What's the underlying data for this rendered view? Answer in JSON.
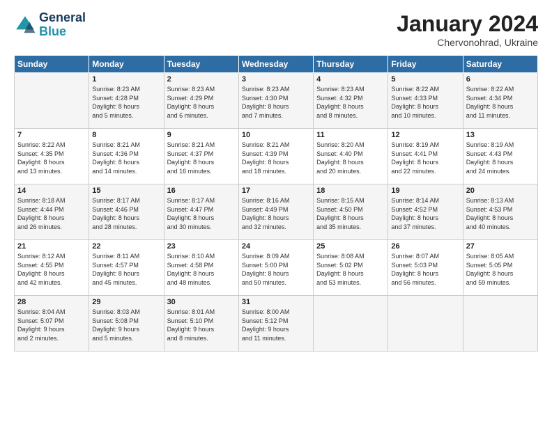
{
  "logo": {
    "line1": "General",
    "line2": "Blue"
  },
  "title": "January 2024",
  "subtitle": "Chervonohrad, Ukraine",
  "days_header": [
    "Sunday",
    "Monday",
    "Tuesday",
    "Wednesday",
    "Thursday",
    "Friday",
    "Saturday"
  ],
  "weeks": [
    [
      {
        "day": "",
        "info": ""
      },
      {
        "day": "1",
        "info": "Sunrise: 8:23 AM\nSunset: 4:28 PM\nDaylight: 8 hours\nand 5 minutes."
      },
      {
        "day": "2",
        "info": "Sunrise: 8:23 AM\nSunset: 4:29 PM\nDaylight: 8 hours\nand 6 minutes."
      },
      {
        "day": "3",
        "info": "Sunrise: 8:23 AM\nSunset: 4:30 PM\nDaylight: 8 hours\nand 7 minutes."
      },
      {
        "day": "4",
        "info": "Sunrise: 8:23 AM\nSunset: 4:32 PM\nDaylight: 8 hours\nand 8 minutes."
      },
      {
        "day": "5",
        "info": "Sunrise: 8:22 AM\nSunset: 4:33 PM\nDaylight: 8 hours\nand 10 minutes."
      },
      {
        "day": "6",
        "info": "Sunrise: 8:22 AM\nSunset: 4:34 PM\nDaylight: 8 hours\nand 11 minutes."
      }
    ],
    [
      {
        "day": "7",
        "info": "Sunrise: 8:22 AM\nSunset: 4:35 PM\nDaylight: 8 hours\nand 13 minutes."
      },
      {
        "day": "8",
        "info": "Sunrise: 8:21 AM\nSunset: 4:36 PM\nDaylight: 8 hours\nand 14 minutes."
      },
      {
        "day": "9",
        "info": "Sunrise: 8:21 AM\nSunset: 4:37 PM\nDaylight: 8 hours\nand 16 minutes."
      },
      {
        "day": "10",
        "info": "Sunrise: 8:21 AM\nSunset: 4:39 PM\nDaylight: 8 hours\nand 18 minutes."
      },
      {
        "day": "11",
        "info": "Sunrise: 8:20 AM\nSunset: 4:40 PM\nDaylight: 8 hours\nand 20 minutes."
      },
      {
        "day": "12",
        "info": "Sunrise: 8:19 AM\nSunset: 4:41 PM\nDaylight: 8 hours\nand 22 minutes."
      },
      {
        "day": "13",
        "info": "Sunrise: 8:19 AM\nSunset: 4:43 PM\nDaylight: 8 hours\nand 24 minutes."
      }
    ],
    [
      {
        "day": "14",
        "info": "Sunrise: 8:18 AM\nSunset: 4:44 PM\nDaylight: 8 hours\nand 26 minutes."
      },
      {
        "day": "15",
        "info": "Sunrise: 8:17 AM\nSunset: 4:46 PM\nDaylight: 8 hours\nand 28 minutes."
      },
      {
        "day": "16",
        "info": "Sunrise: 8:17 AM\nSunset: 4:47 PM\nDaylight: 8 hours\nand 30 minutes."
      },
      {
        "day": "17",
        "info": "Sunrise: 8:16 AM\nSunset: 4:49 PM\nDaylight: 8 hours\nand 32 minutes."
      },
      {
        "day": "18",
        "info": "Sunrise: 8:15 AM\nSunset: 4:50 PM\nDaylight: 8 hours\nand 35 minutes."
      },
      {
        "day": "19",
        "info": "Sunrise: 8:14 AM\nSunset: 4:52 PM\nDaylight: 8 hours\nand 37 minutes."
      },
      {
        "day": "20",
        "info": "Sunrise: 8:13 AM\nSunset: 4:53 PM\nDaylight: 8 hours\nand 40 minutes."
      }
    ],
    [
      {
        "day": "21",
        "info": "Sunrise: 8:12 AM\nSunset: 4:55 PM\nDaylight: 8 hours\nand 42 minutes."
      },
      {
        "day": "22",
        "info": "Sunrise: 8:11 AM\nSunset: 4:57 PM\nDaylight: 8 hours\nand 45 minutes."
      },
      {
        "day": "23",
        "info": "Sunrise: 8:10 AM\nSunset: 4:58 PM\nDaylight: 8 hours\nand 48 minutes."
      },
      {
        "day": "24",
        "info": "Sunrise: 8:09 AM\nSunset: 5:00 PM\nDaylight: 8 hours\nand 50 minutes."
      },
      {
        "day": "25",
        "info": "Sunrise: 8:08 AM\nSunset: 5:02 PM\nDaylight: 8 hours\nand 53 minutes."
      },
      {
        "day": "26",
        "info": "Sunrise: 8:07 AM\nSunset: 5:03 PM\nDaylight: 8 hours\nand 56 minutes."
      },
      {
        "day": "27",
        "info": "Sunrise: 8:05 AM\nSunset: 5:05 PM\nDaylight: 8 hours\nand 59 minutes."
      }
    ],
    [
      {
        "day": "28",
        "info": "Sunrise: 8:04 AM\nSunset: 5:07 PM\nDaylight: 9 hours\nand 2 minutes."
      },
      {
        "day": "29",
        "info": "Sunrise: 8:03 AM\nSunset: 5:08 PM\nDaylight: 9 hours\nand 5 minutes."
      },
      {
        "day": "30",
        "info": "Sunrise: 8:01 AM\nSunset: 5:10 PM\nDaylight: 9 hours\nand 8 minutes."
      },
      {
        "day": "31",
        "info": "Sunrise: 8:00 AM\nSunset: 5:12 PM\nDaylight: 9 hours\nand 11 minutes."
      },
      {
        "day": "",
        "info": ""
      },
      {
        "day": "",
        "info": ""
      },
      {
        "day": "",
        "info": ""
      }
    ]
  ]
}
